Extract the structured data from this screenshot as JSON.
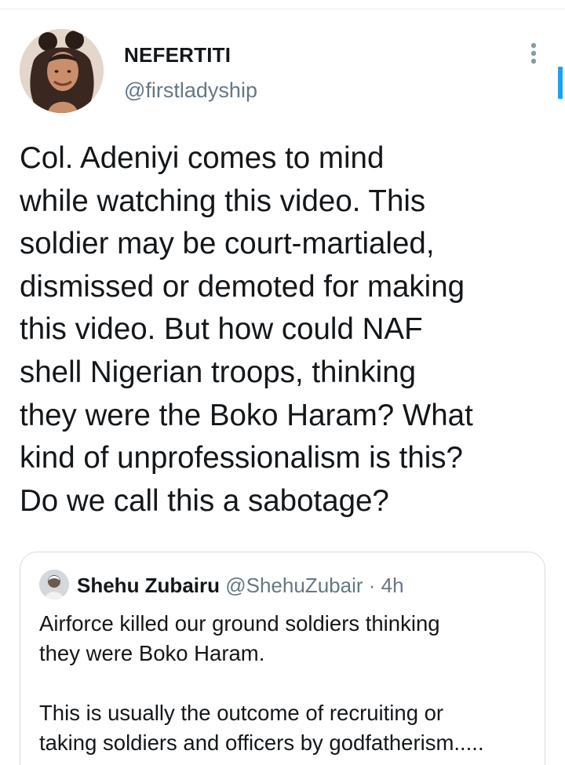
{
  "tweet": {
    "author": {
      "display_name": "NEFERTITI",
      "handle": "@firstladyship"
    },
    "text": "Col. Adeniyi comes to mind\nwhile watching this video. This\nsoldier may be court-martialed,\ndismissed or demoted for making\nthis video. But how could NAF\nshell Nigerian troops, thinking\nthey were the Boko Haram? What\nkind of unprofessionalism is this?\nDo we call this a sabotage?"
  },
  "quoted_tweet": {
    "author": {
      "display_name": "Shehu Zubairu",
      "handle": "@ShehuZubair",
      "separator": "·",
      "timestamp": "4h"
    },
    "text": "Airforce killed our ground soldiers thinking\nthey were Boko Haram.\n\nThis is usually the outcome of recruiting or\ntaking soldiers and officers by godfatherism....."
  },
  "icons": {
    "more": "more-vertical-icon",
    "avatar": "profile-photo",
    "quote_avatar": "profile-photo"
  },
  "colors": {
    "text": "#14171a",
    "secondary_text": "#657786",
    "border": "#d6dde3",
    "accent": "#1da1f2"
  }
}
